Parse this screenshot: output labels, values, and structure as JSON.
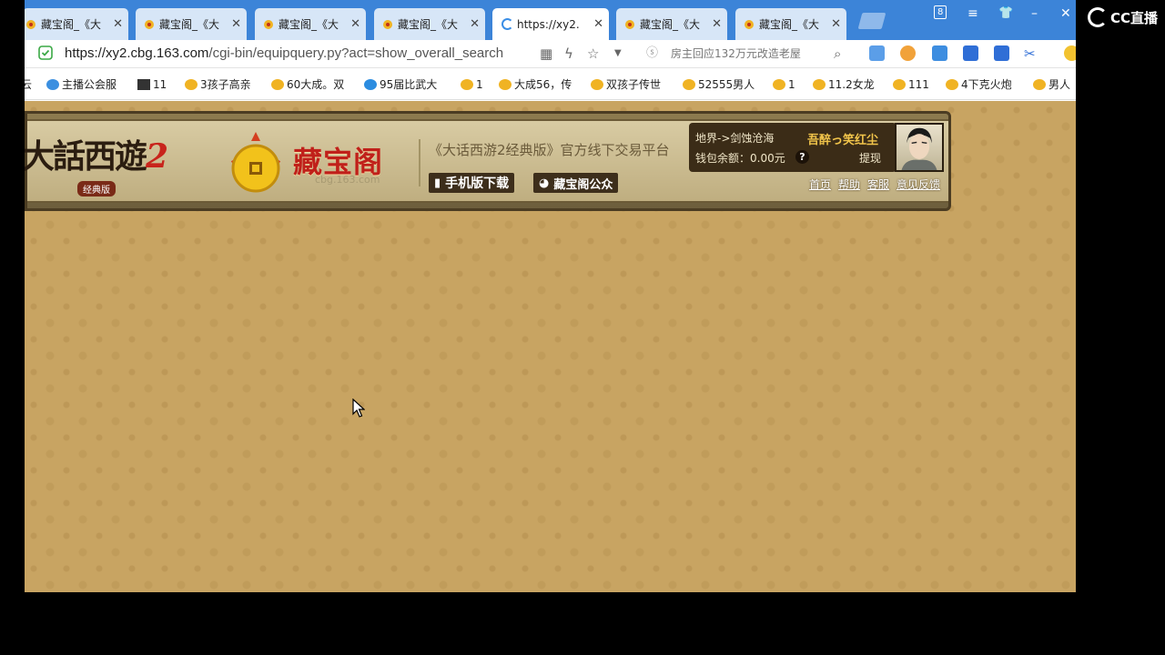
{
  "tabs": [
    {
      "title": "藏宝阁_《大",
      "active": false
    },
    {
      "title": "藏宝阁_《大",
      "active": false
    },
    {
      "title": "藏宝阁_《大",
      "active": false
    },
    {
      "title": "藏宝阁_《大",
      "active": false
    },
    {
      "title": "https://xy2.",
      "active": true
    },
    {
      "title": "藏宝阁_《大",
      "active": false
    },
    {
      "title": "藏宝阁_《大",
      "active": false
    }
  ],
  "window_controls": {
    "badge": "8",
    "menu": "≡",
    "shirt": "👕",
    "minimize": "–",
    "close": "✕"
  },
  "address": {
    "host": "https://xy2.cbg.163.com",
    "path": "/cgi-bin/equipquery.py?act=show_overall_search",
    "search_hint": "房主回应132万元改造老屋"
  },
  "bookmarks": [
    "主播公会服",
    "11",
    "3孩子高亲",
    "60大成。双",
    "95届比武大",
    "1",
    "大成56，传",
    "双孩子传世",
    "52555男人",
    "1",
    "11.2女龙",
    "111",
    "4下克火炮",
    "男人"
  ],
  "banner": {
    "game_logo": "大話西遊",
    "game_logo_num": "2",
    "game_logo_sub": "经典版",
    "site_name": "藏宝阁",
    "site_domain": "cbg.163.com",
    "platform": "《大话西游2经典版》官方线下交易平台",
    "mobile_download": "手机版下载",
    "wechat": "藏宝阁公众",
    "server": "地界->剑蚀沧海",
    "username": "吾醉っ笑红尘",
    "wallet": "钱包余额：0.00元",
    "help": "?",
    "withdraw": "提现",
    "nav": [
      "首页",
      "帮助",
      "客服",
      "意见反馈"
    ]
  },
  "cc_logo": "CC直播"
}
